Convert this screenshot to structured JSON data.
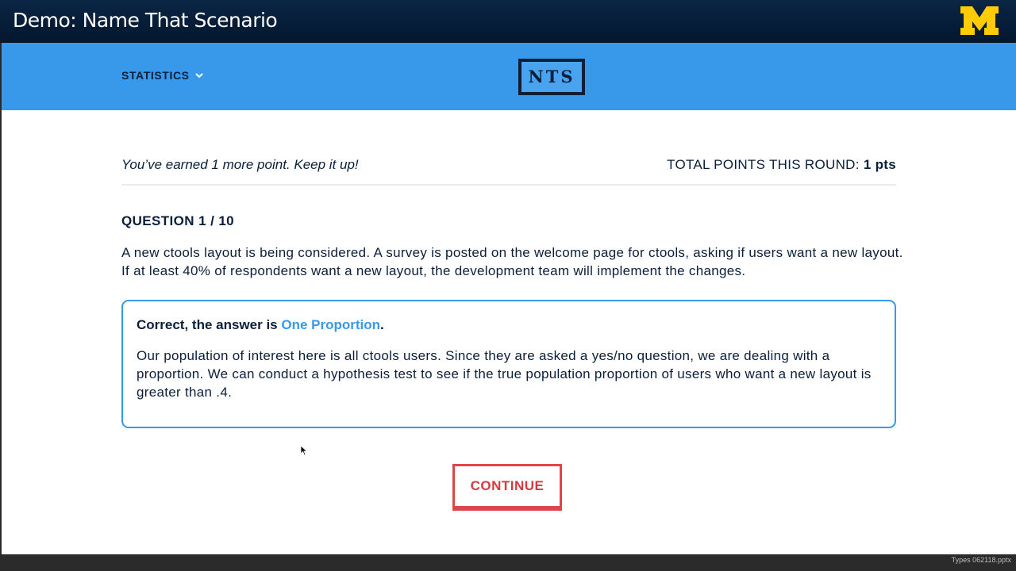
{
  "slide": {
    "title": "Demo: Name That Scenario",
    "logo": "block-m-logo",
    "file_label": "Types 062118.pptx"
  },
  "navbar": {
    "menu_label": "STATISTICS",
    "menu_icon": "chevron-down-icon",
    "logo_text": "NTS"
  },
  "status": {
    "feedback": "You’ve earned 1 more point. Keep it up!",
    "points_label": "TOTAL POINTS THIS ROUND:",
    "points_value": "1 pts"
  },
  "question": {
    "number": "QUESTION 1 / 10",
    "text": "A new ctools layout is being considered. A survey is posted on the welcome page for ctools, asking if users want a new layout. If at least 40% of respondents want a new layout, the development team will implement the changes."
  },
  "answer": {
    "prefix": "Correct, the answer is",
    "name": "One Proportion",
    "suffix": ".",
    "explanation": "Our population of interest here is all ctools users. Since they are asked a yes/no question, we are dealing with a proportion. We can conduct a hypothesis test to see if the true population proportion of users who want a new layout is greater than .4."
  },
  "actions": {
    "continue_label": "CONTINUE"
  },
  "colors": {
    "title_bar": "#04172d",
    "navbar": "#3898ea",
    "text": "#0b1f3a",
    "accent": "#3898ea",
    "button": "#e0454b",
    "logo_m": "#ffcb05"
  }
}
